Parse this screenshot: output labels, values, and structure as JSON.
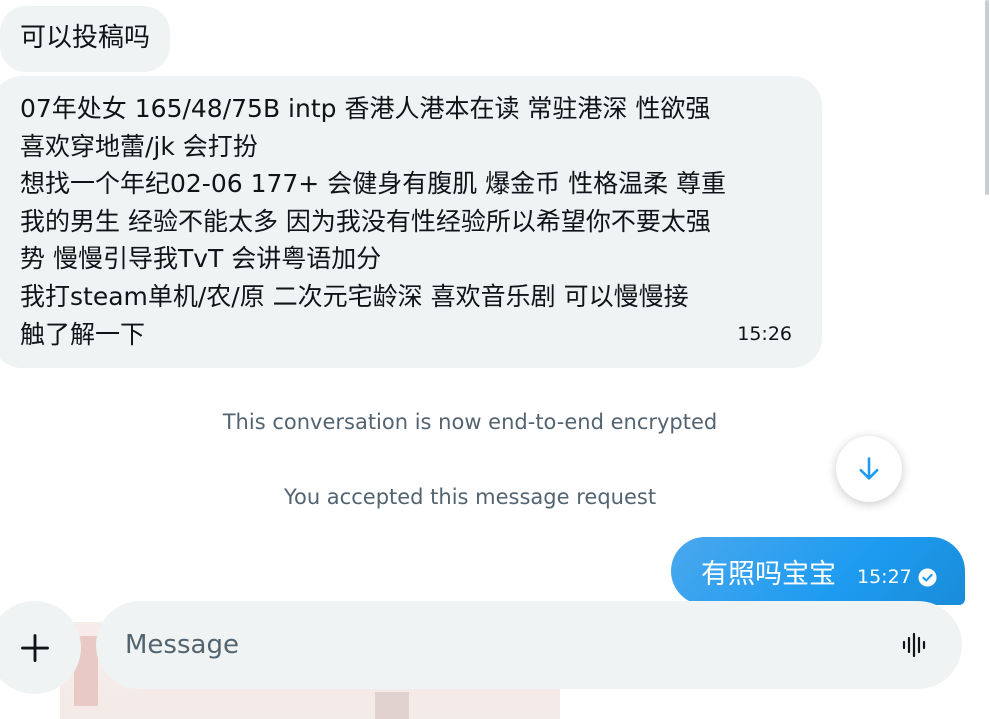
{
  "messages": {
    "incoming_short": {
      "text": "可以投稿吗"
    },
    "incoming_long": {
      "lines": [
        "07年处女 165/48/75B intp 香港人港本在读 常驻港深 性欲强",
        "喜欢穿地蕾/jk 会打扮",
        "想找一个年纪02-06 177+ 会健身有腹肌 爆金币 性格温柔 尊重",
        "我的男生 经验不能太多 因为我没有性经验所以希望你不要太强",
        "势 慢慢引导我TvT 会讲粤语加分",
        "我打steam单机/农/原 二次元宅龄深 喜欢音乐剧 可以慢慢接",
        "触了解一下"
      ],
      "time": "15:26"
    },
    "outgoing": {
      "text": "有照吗宝宝",
      "time": "15:27",
      "status_icon": "sent-check-icon"
    }
  },
  "system": {
    "encrypted": "This conversation is now end-to-end encrypted",
    "accepted": "You accepted this message request"
  },
  "scroll_button": {
    "icon": "arrow-down-icon"
  },
  "composer": {
    "add_icon": "plus-icon",
    "placeholder": "Message",
    "value": "",
    "voice_icon": "voice-waveform-icon"
  },
  "colors": {
    "incoming_bubble": "#eff3f4",
    "outgoing_bubble": "#1d9bf0",
    "system_text": "#536471",
    "accent": "#1d9bf0"
  }
}
